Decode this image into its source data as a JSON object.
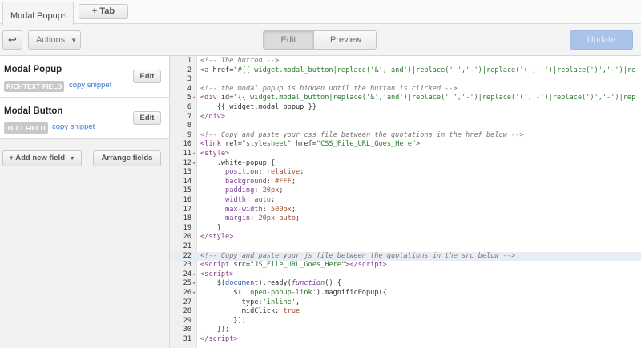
{
  "tabs": {
    "active": "Modal Popup",
    "close": "×",
    "add": "+ Tab"
  },
  "toolbar": {
    "back_icon": "↩",
    "actions": "Actions",
    "edit": "Edit",
    "preview": "Preview",
    "update": "Update",
    "accent": "#a9c4e8"
  },
  "fields": [
    {
      "title": "Modal Popup",
      "type": "RICHTEXT FIELD",
      "snippet": "copy snippet",
      "edit": "Edit"
    },
    {
      "title": "Modal Button",
      "type": "TEXT FIELD",
      "snippet": "copy snippet",
      "edit": "Edit"
    }
  ],
  "left_actions": {
    "add": "+ Add new field",
    "arrange": "Arrange fields"
  },
  "editor": {
    "active_line": 22,
    "folds": [
      5,
      11,
      12,
      24,
      25,
      26
    ],
    "lines": [
      [
        [
          "c",
          "<!-- The button -->"
        ]
      ],
      [
        [
          "g",
          "<a "
        ],
        [
          "a",
          "href="
        ],
        [
          "s",
          "\"#{{ widget.modal_button|replace('&','and')|replace(' ','-')|replace('(','-')|replace(')','-')|re"
        ]
      ],
      [],
      [
        [
          "c",
          "<!-- the modal popup is hidden until the button is clicked -->"
        ]
      ],
      [
        [
          "g",
          "<div "
        ],
        [
          "a",
          "id="
        ],
        [
          "s",
          "\"{{ widget.modal_button|replace('&','and')|replace(' ','-')|replace('(','-')|replace(')','-')|rep"
        ]
      ],
      [
        [
          "x",
          "    {{ widget.modal_popup }}"
        ]
      ],
      [
        [
          "g",
          "</div>"
        ]
      ],
      [],
      [
        [
          "c",
          "<!-- Copy and paste your css file between the quotations in the href below -->"
        ]
      ],
      [
        [
          "g",
          "<link "
        ],
        [
          "a",
          "rel="
        ],
        [
          "s",
          "\"stylesheet\""
        ],
        [
          "a",
          " href="
        ],
        [
          "s",
          "\"CSS_File_URL_Goes_Here\""
        ],
        [
          "g",
          ">"
        ]
      ],
      [
        [
          "g",
          "<style>"
        ]
      ],
      [
        [
          "x",
          "    .white-popup {"
        ]
      ],
      [
        [
          "x",
          "      "
        ],
        [
          "p",
          "position"
        ],
        [
          "x",
          ": "
        ],
        [
          "v",
          "relative"
        ],
        [
          "x",
          ";"
        ]
      ],
      [
        [
          "x",
          "      "
        ],
        [
          "p",
          "background"
        ],
        [
          "x",
          ": "
        ],
        [
          "n",
          "#FFF"
        ],
        [
          "x",
          ";"
        ]
      ],
      [
        [
          "x",
          "      "
        ],
        [
          "p",
          "padding"
        ],
        [
          "x",
          ": "
        ],
        [
          "n",
          "20px"
        ],
        [
          "x",
          ";"
        ]
      ],
      [
        [
          "x",
          "      "
        ],
        [
          "p",
          "width"
        ],
        [
          "x",
          ": "
        ],
        [
          "v",
          "auto"
        ],
        [
          "x",
          ";"
        ]
      ],
      [
        [
          "x",
          "      "
        ],
        [
          "p",
          "max-width"
        ],
        [
          "x",
          ": "
        ],
        [
          "n",
          "500px"
        ],
        [
          "x",
          ";"
        ]
      ],
      [
        [
          "x",
          "      "
        ],
        [
          "p",
          "margin"
        ],
        [
          "x",
          ": "
        ],
        [
          "n",
          "20px"
        ],
        [
          "x",
          " "
        ],
        [
          "v",
          "auto"
        ],
        [
          "x",
          ";"
        ]
      ],
      [
        [
          "x",
          "    }"
        ]
      ],
      [
        [
          "g",
          "</style>"
        ]
      ],
      [],
      [
        [
          "c",
          "<!-- Copy and paste your js file between the quotations in the src below -->"
        ]
      ],
      [
        [
          "g",
          "<script "
        ],
        [
          "a",
          "src="
        ],
        [
          "s",
          "\"JS_File_URL_Goes_Here\""
        ],
        [
          "g",
          "></script>"
        ]
      ],
      [
        [
          "g",
          "<script>"
        ]
      ],
      [
        [
          "x",
          "    $("
        ],
        [
          "d",
          "document"
        ],
        [
          "x",
          ").ready("
        ],
        [
          "k",
          "function"
        ],
        [
          "x",
          "() {"
        ]
      ],
      [
        [
          "x",
          "        $("
        ],
        [
          "s",
          "'.open-popup-link'"
        ],
        [
          "x",
          ").magnificPopup({"
        ]
      ],
      [
        [
          "x",
          "          type:"
        ],
        [
          "s",
          "'inline'"
        ],
        [
          "x",
          ","
        ]
      ],
      [
        [
          "x",
          "          midClick: "
        ],
        [
          "v",
          "true"
        ]
      ],
      [
        [
          "x",
          "        });"
        ]
      ],
      [
        [
          "x",
          "    });"
        ]
      ],
      [
        [
          "g",
          "</script>"
        ]
      ]
    ]
  }
}
